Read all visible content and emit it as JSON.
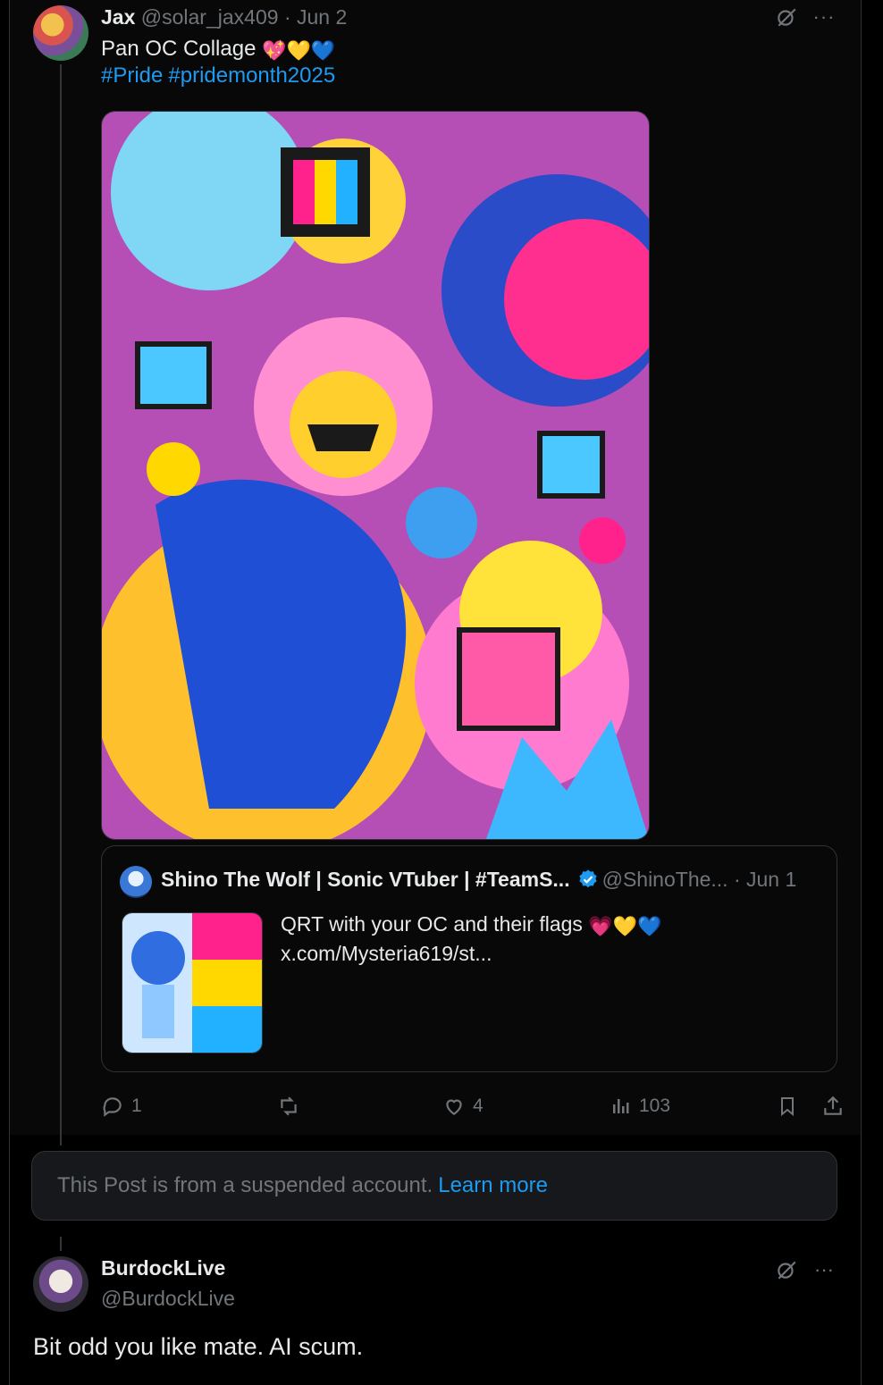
{
  "post": {
    "author_name": "Jax",
    "author_handle": "@solar_jax409",
    "separator": "·",
    "date": "Jun 2",
    "text": "Pan OC Collage",
    "emoji_hearts": [
      "💖",
      "💛",
      "💙"
    ],
    "hashtags": [
      "#Pride",
      "#pridemonth2025"
    ],
    "image_alt": "Colorful pansexual pride OC collage illustration",
    "icons": {
      "grok": "grok-icon",
      "more": "more-icon"
    }
  },
  "quote": {
    "author_name": "Shino The Wolf | Sonic VTuber | #TeamS...",
    "author_handle": "@ShinoThe...",
    "date": "· Jun 1",
    "text": "QRT with your OC and their flags",
    "hearts": [
      "💗",
      "💛",
      "💙"
    ],
    "link": "x.com/Mysteria619/st...",
    "verified_color": "#1d9bf0",
    "flag_colors": [
      "#ff218c",
      "#ffd800",
      "#21b1ff"
    ]
  },
  "actions": {
    "reply_count": "1",
    "repost_count": "",
    "like_count": "4",
    "views_count": "103"
  },
  "suspended_notice": {
    "text": "This Post is from a suspended account.",
    "link": "Learn more"
  },
  "reply": {
    "author_name": "BurdockLive",
    "author_handle": "@BurdockLive",
    "text": "Bit odd you like mate. AI scum."
  },
  "colors": {
    "accent": "#1d9bf0",
    "muted": "#71767b",
    "text": "#e7e9ea",
    "background": "#000000"
  }
}
